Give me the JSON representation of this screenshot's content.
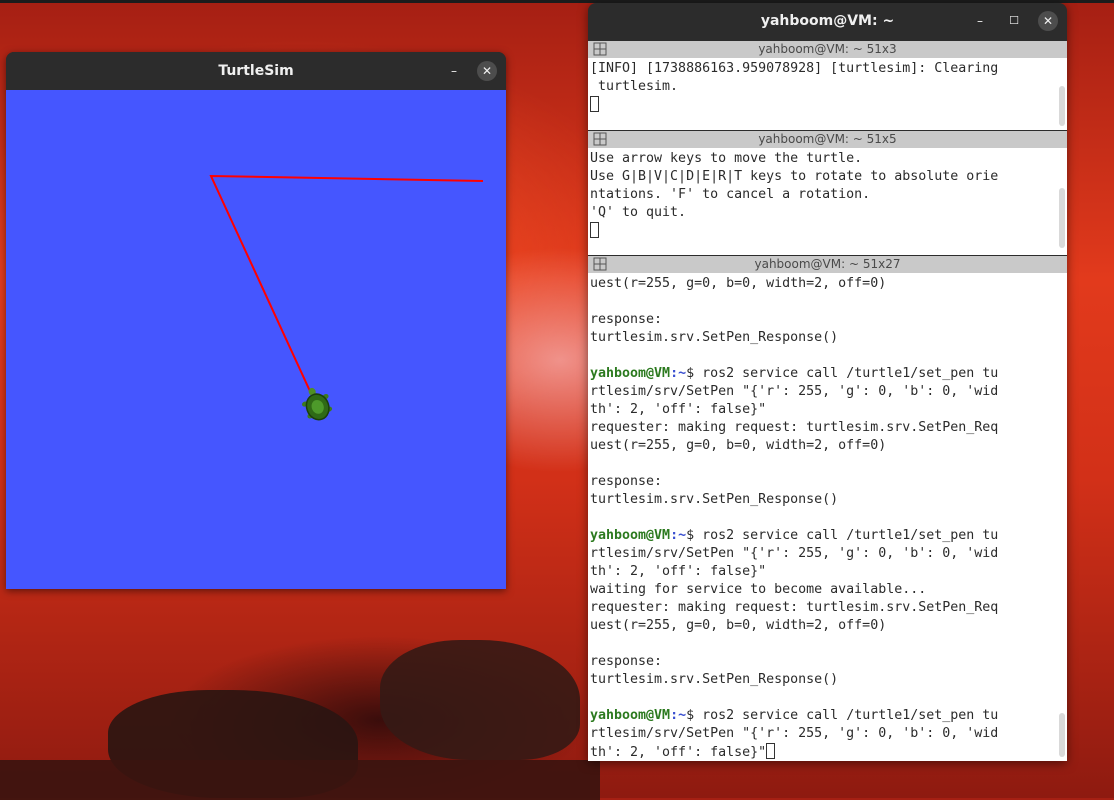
{
  "turtlesim_window": {
    "title": "TurtleSim",
    "minimize_symbol": "–",
    "close_symbol": "✕",
    "canvas_color": "#4556ff",
    "pen_color": "#ff0000"
  },
  "terminal_window": {
    "title": "yahboom@VM: ~",
    "minimize_symbol": "–",
    "maximize_symbol": "☐",
    "close_symbol": "✕",
    "panes": [
      {
        "header": "yahboom@VM: ~ 51x3",
        "lines": [
          "[INFO] [1738886163.959078928] [turtlesim]: Clearing",
          " turtlesim."
        ]
      },
      {
        "header": "yahboom@VM: ~ 51x5",
        "lines": [
          "Use arrow keys to move the turtle.",
          "Use G|B|V|C|D|E|R|T keys to rotate to absolute orie",
          "ntations. 'F' to cancel a rotation.",
          "'Q' to quit."
        ]
      },
      {
        "header": "yahboom@VM: ~ 51x27",
        "prompt_user": "yahboom@VM",
        "prompt_path": ":~",
        "prompt_symbol": "$",
        "lines": [
          "uest(r=255, g=0, b=0, width=2, off=0)",
          "",
          "response:",
          "turtlesim.srv.SetPen_Response()",
          "",
          " ros2 service call /turtle1/set_pen tu",
          "rtlesim/srv/SetPen \"{'r': 255, 'g': 0, 'b': 0, 'wid",
          "th': 2, 'off': false}\"",
          "requester: making request: turtlesim.srv.SetPen_Req",
          "uest(r=255, g=0, b=0, width=2, off=0)",
          "",
          "response:",
          "turtlesim.srv.SetPen_Response()",
          "",
          " ros2 service call /turtle1/set_pen tu",
          "rtlesim/srv/SetPen \"{'r': 255, 'g': 0, 'b': 0, 'wid",
          "th': 2, 'off': false}\"",
          "waiting for service to become available...",
          "requester: making request: turtlesim.srv.SetPen_Req",
          "uest(r=255, g=0, b=0, width=2, off=0)",
          "",
          "response:",
          "turtlesim.srv.SetPen_Response()",
          "",
          " ros2 service call /turtle1/set_pen tu",
          "rtlesim/srv/SetPen \"{'r': 255, 'g': 0, 'b': 0, 'wid",
          "th': 2, 'off': false}\""
        ]
      }
    ]
  }
}
